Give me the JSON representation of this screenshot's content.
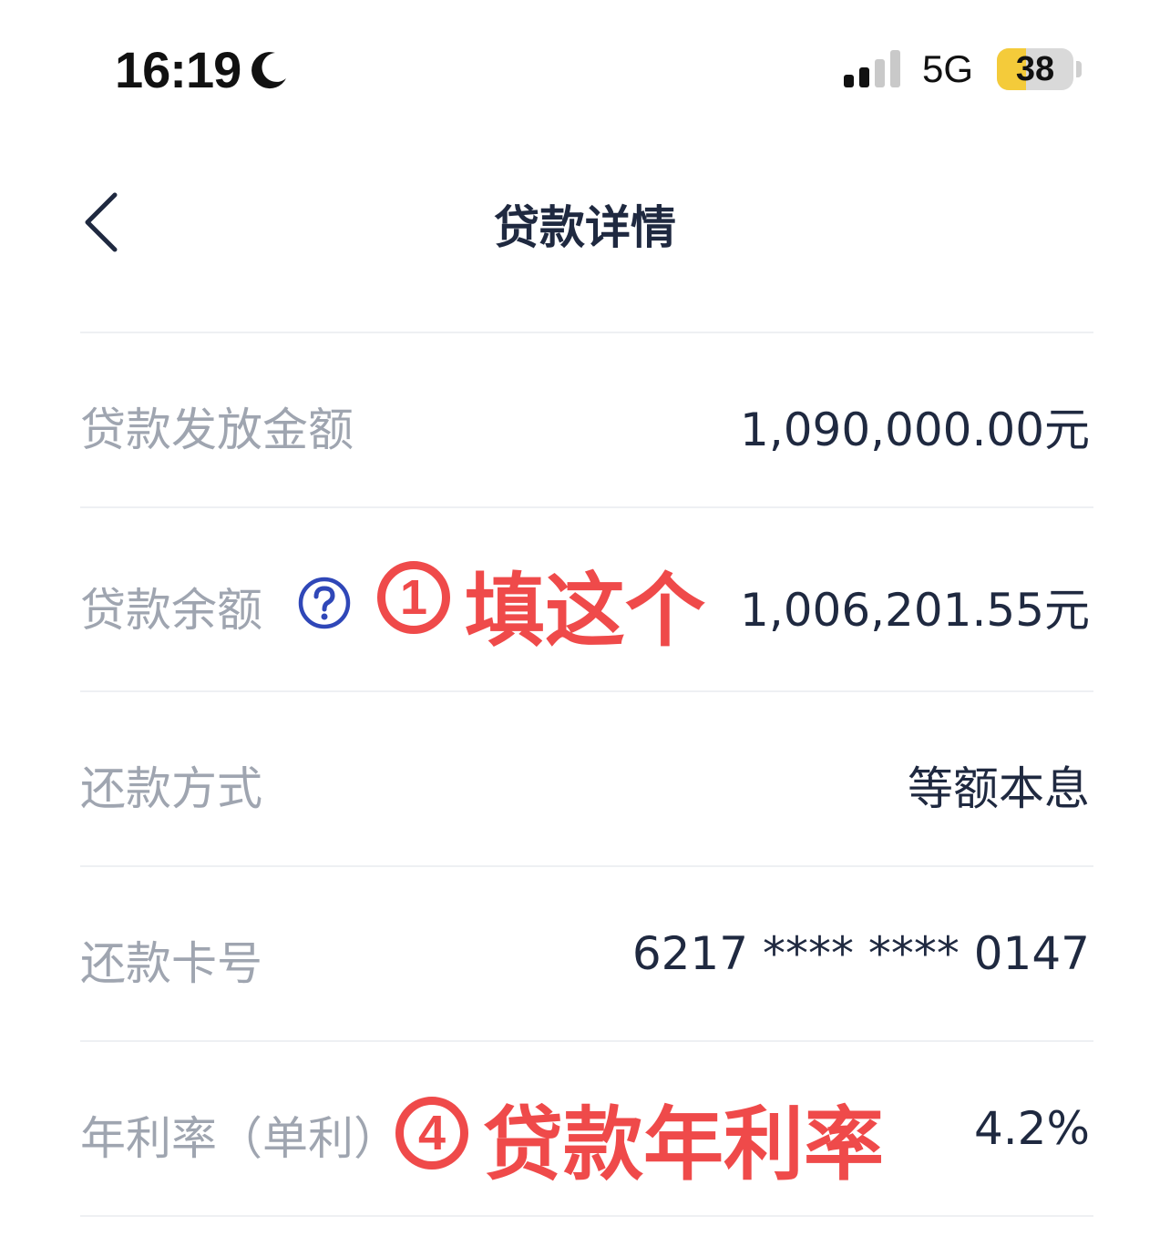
{
  "status_bar": {
    "time": "16:19",
    "network": "5G",
    "battery_level": "38",
    "battery_fraction": 0.38
  },
  "nav": {
    "title": "贷款详情"
  },
  "rows": [
    {
      "label": "贷款发放金额",
      "value": "1,090,000.00元"
    },
    {
      "label": "贷款余额",
      "value": "1,006,201.55元"
    },
    {
      "label": "还款方式",
      "value": "等额本息"
    },
    {
      "label": "还款卡号",
      "value": "6217 **** **** 0147"
    },
    {
      "label": "年利率（单利）",
      "value": "4.2%"
    }
  ],
  "annotations": [
    {
      "marker": "1",
      "text": "填这个"
    },
    {
      "marker": "4",
      "text": "贷款年利率"
    }
  ],
  "colors": {
    "annotation": "#ef4a4a",
    "help_icon": "#2f47b8",
    "label": "#9fa5b0",
    "value": "#1f2940"
  }
}
